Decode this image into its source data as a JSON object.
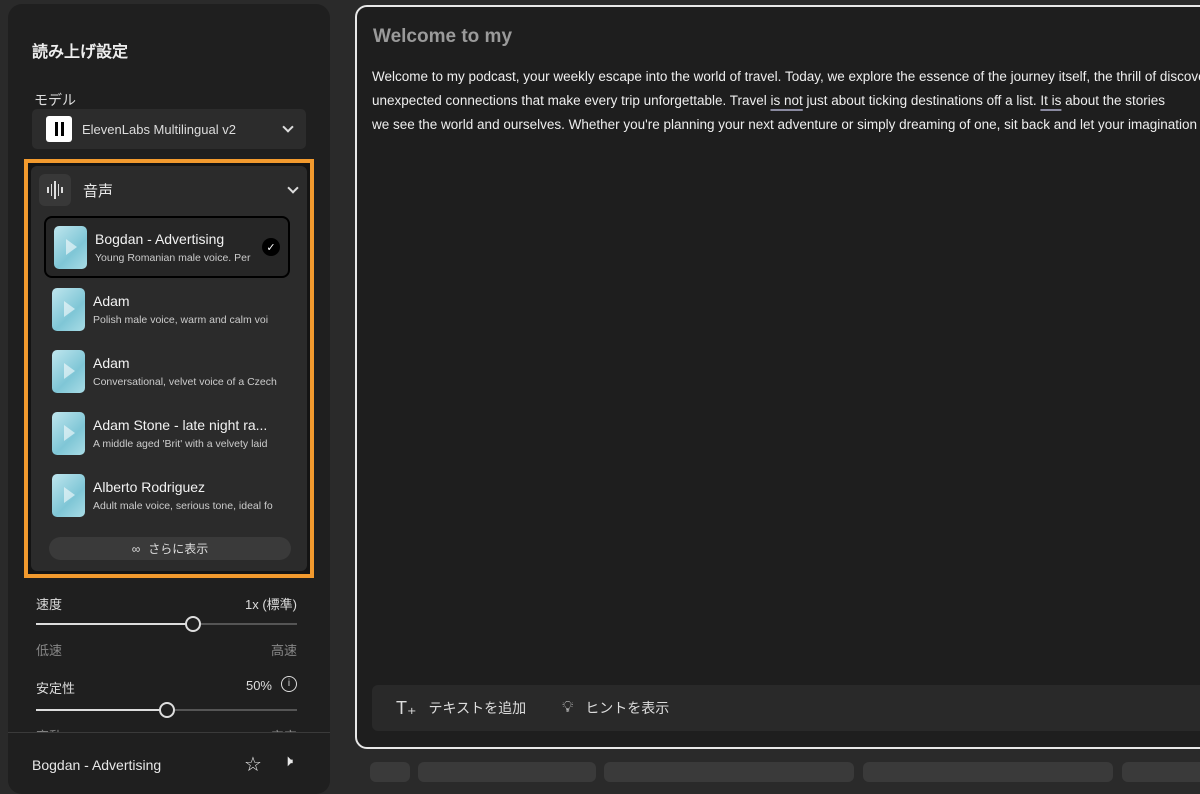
{
  "panel": {
    "title": "読み上げ設定",
    "model_label": "モデル",
    "model_value": "ElevenLabs Multilingual v2",
    "voice_label": "音声",
    "voices": [
      {
        "name": "Bogdan - Advertising",
        "desc": "Young Romanian male voice. Per",
        "selected": true
      },
      {
        "name": "Adam",
        "desc": "Polish male voice, warm and calm voi"
      },
      {
        "name": "Adam",
        "desc": "Conversational, velvet voice of a Czech"
      },
      {
        "name": "Adam Stone - late night ra...",
        "desc": "A middle aged 'Brit' with a velvety laid"
      },
      {
        "name": "Alberto Rodriguez",
        "desc": "Adult male voice, serious tone, ideal fo"
      }
    ],
    "show_more": "さらに表示",
    "speed": {
      "label": "速度",
      "value": "1x (標準)",
      "min_label": "低速",
      "max_label": "高速",
      "fraction": 0.6
    },
    "stability": {
      "label": "安定性",
      "value": "50%",
      "min_label": "変動",
      "max_label": "安定",
      "fraction": 0.5
    },
    "current_voice": "Bogdan - Advertising"
  },
  "editor": {
    "title": "Welcome to my",
    "line1": "Welcome to my podcast, your weekly escape into the world of travel. Today, we explore the essence of the journey itself, the thrill of discovery, the",
    "line2a": "unexpected connections that make every trip unforgettable. Travel ",
    "line2b": "is not",
    "line2c": " just about ticking destinations off a list. ",
    "line2d": "It is",
    "line2e": " about the stories",
    "line3": "we see the world and ourselves. Whether you're planning your next adventure or simply dreaming of one, sit back and let your imagination",
    "add_text": "テキストを追加",
    "show_hints": "ヒントを表示"
  },
  "colors": {
    "accent": "#f29a2e"
  }
}
